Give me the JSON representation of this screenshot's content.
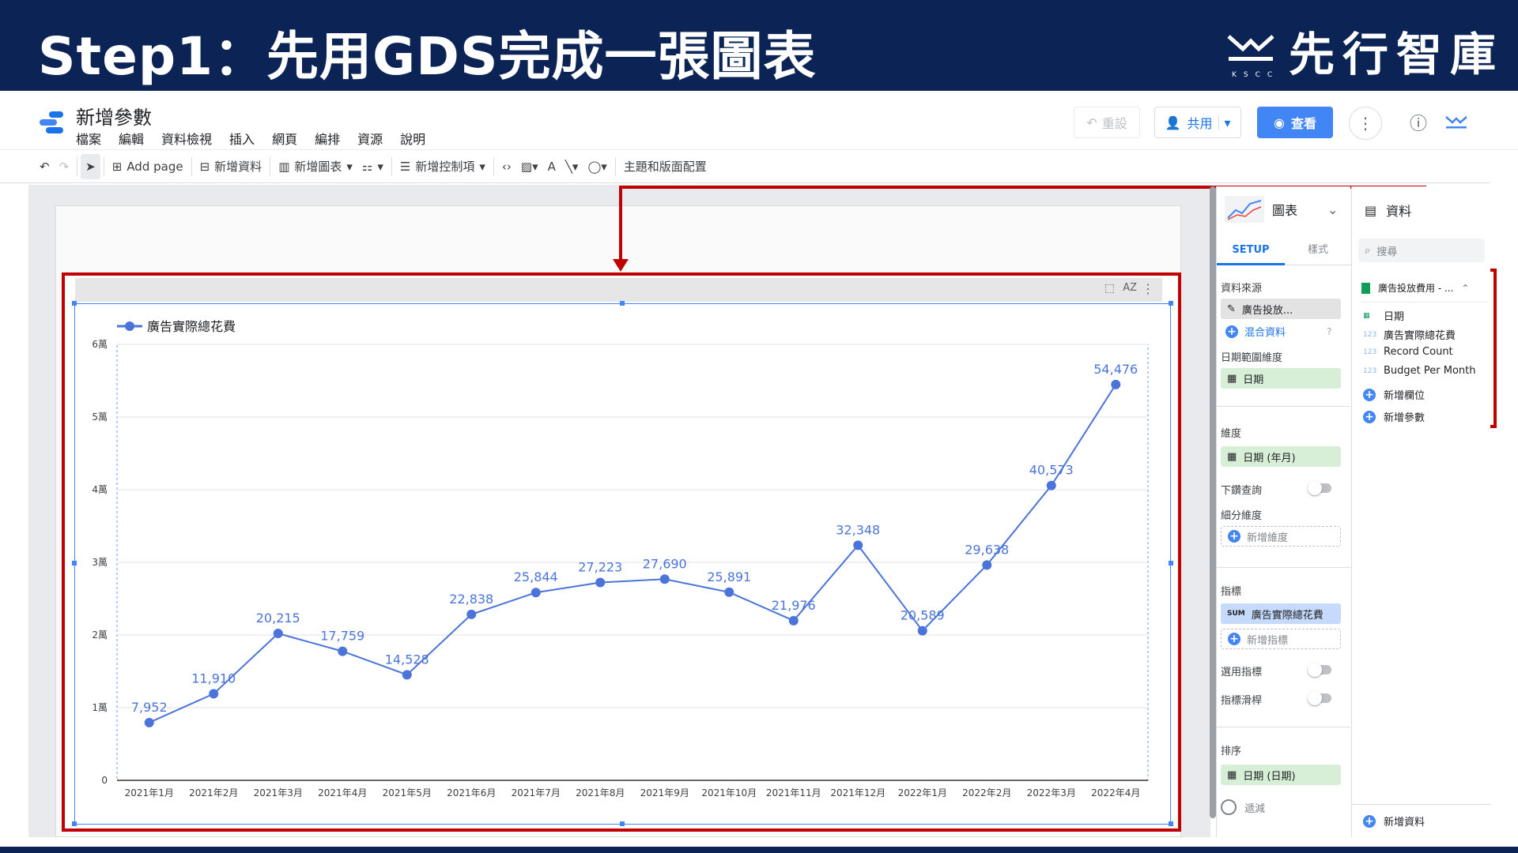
{
  "banner": {
    "title": "Step1：先用GDS完成一張圖表",
    "brand_name": "先行智庫",
    "brand_sub": "KSCC"
  },
  "app": {
    "report_title": "新增參數",
    "menu": [
      "檔案",
      "編輯",
      "資料檢視",
      "插入",
      "網頁",
      "編排",
      "資源",
      "說明"
    ],
    "reset_label": "重設",
    "share_label": "共用",
    "view_label": "查看"
  },
  "toolbar": {
    "add_page": "Add page",
    "add_data": "新增資料",
    "add_chart": "新增圖表",
    "add_control": "新增控制項",
    "theme": "主題和版面配置"
  },
  "props": {
    "chart_type": "圖表",
    "tab_setup": "SETUP",
    "tab_style": "樣式",
    "data_source_label": "資料來源",
    "data_source_value": "廣告投放...",
    "blend_data": "混合資料",
    "date_range_label": "日期範圍維度",
    "date_range_value": "日期",
    "dimension_label": "維度",
    "dimension_value": "日期 (年月)",
    "drilldown_label": "下鑽查詢",
    "breakdown_label": "細分維度",
    "add_dimension": "新增維度",
    "metric_label": "指標",
    "metric_agg": "SUM",
    "metric_value": "廣告實際總花費",
    "add_metric": "新增指標",
    "optional_metrics": "選用指標",
    "metric_slider": "指標滑桿",
    "sort_label": "排序",
    "sort_value": "日期 (日期)",
    "filter_label": "遞減"
  },
  "data_panel": {
    "title": "資料",
    "search_placeholder": "搜尋",
    "source": "廣告投放費用 - ...",
    "fields": [
      {
        "type": "date",
        "name": "日期"
      },
      {
        "type": "123",
        "name": "廣告實際總花費"
      },
      {
        "type": "123",
        "name": "Record Count"
      },
      {
        "type": "123",
        "name": "Budget Per Month"
      }
    ],
    "add_field": "新增欄位",
    "add_param": "新增參數",
    "add_data": "新增資料"
  },
  "chart_data": {
    "type": "line",
    "categories": [
      "2021年1月",
      "2021年2月",
      "2021年3月",
      "2021年4月",
      "2021年5月",
      "2021年6月",
      "2021年7月",
      "2021年8月",
      "2021年9月",
      "2021年10月",
      "2021年11月",
      "2021年12月",
      "2022年1月",
      "2022年2月",
      "2022年3月",
      "2022年4月"
    ],
    "series": [
      {
        "name": "廣告實際總花費",
        "values": [
          7952,
          11910,
          20215,
          17759,
          14528,
          22838,
          25844,
          27223,
          27690,
          25891,
          21976,
          32348,
          20589,
          29638,
          40573,
          54476
        ]
      }
    ],
    "value_labels": [
      "7,952",
      "11,910",
      "20,215",
      "17,759",
      "14,528",
      "22,838",
      "25,844",
      "27,223",
      "27,690",
      "25,891",
      "21,976",
      "32,348",
      "20,589",
      "29,638",
      "40,573",
      "54,476"
    ],
    "y_ticks": [
      "0",
      "1萬",
      "2萬",
      "3萬",
      "4萬",
      "5萬",
      "6萬"
    ],
    "ylim": [
      0,
      60000
    ],
    "legend_position": "top-left",
    "color": "#4a74d9"
  }
}
